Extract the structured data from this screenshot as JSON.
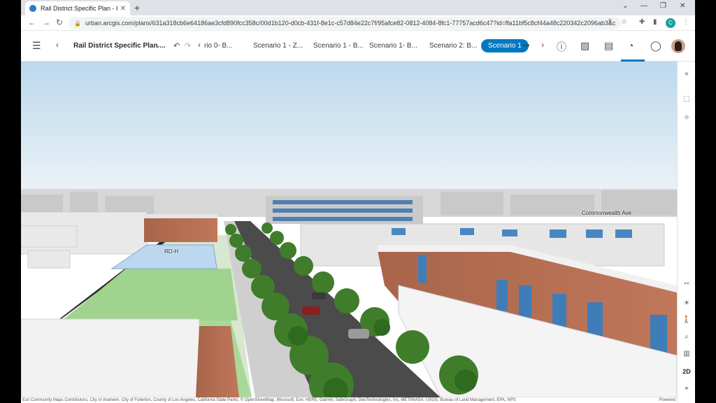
{
  "browser": {
    "tab_title": "Rail District Specific Plan - Housi",
    "url": "urban.arcgis.com/plans/631a318cb6e64186ae3cfd890fcc358c/00d1b120-d0cb-431f-8e1c-c57d84e22c7f/95afce82-0812-4084-8fc1-77757acd6c47?id=ffa11bf5c8cf44a48c220342c2096ab3&c...",
    "profile_initial": "C"
  },
  "app": {
    "plan_title": "Rail District Specific Plan ...",
    "scenarios": [
      "rio 0- B...",
      "Scenario 1 - Z...",
      "Scenario 1 - B...",
      "Scenario 1- B...",
      "Scenario 2: B...",
      "Scenario 1"
    ],
    "more": "•••"
  },
  "scene": {
    "labels": {
      "street": "Commonwealth Ave",
      "zone": "RD-H"
    }
  },
  "rail": {
    "mode": "2D"
  },
  "attribution": {
    "text": "Esri Community Maps Contributors, City of Anaheim, City of Fullerton, County of Los Angeles, California State Parks, © OpenStreetMap, Microsoft, Esri, HERE, Garmin, SafeGraph, GeoTechnologies, Inc, METI/NASA, USGS, Bureau of Land Management, EPA, NPS",
    "powered": "Powered"
  }
}
